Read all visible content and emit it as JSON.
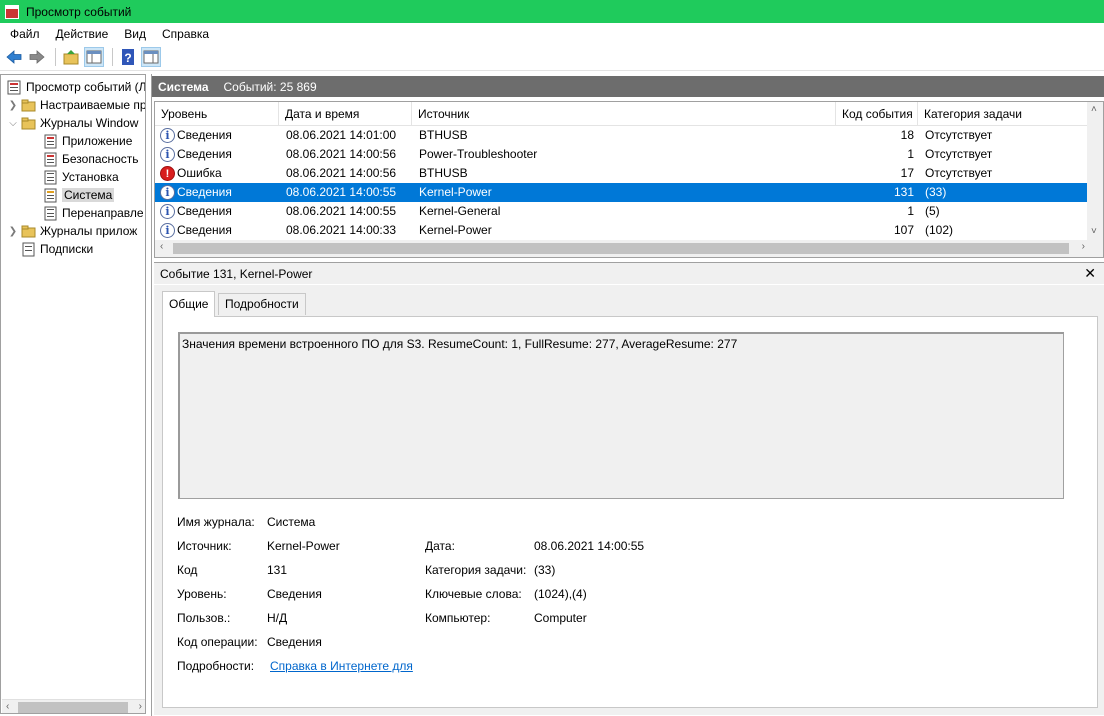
{
  "window": {
    "title": "Просмотр событий"
  },
  "menu": [
    "Файл",
    "Действие",
    "Вид",
    "Справка"
  ],
  "tree": {
    "root": "Просмотр событий (Л",
    "custom_views": "Настраиваемые пр",
    "windows_logs": "Журналы Window",
    "logs": [
      "Приложение",
      "Безопасность",
      "Установка",
      "Система",
      "Перенаправле"
    ],
    "app_logs": "Журналы прилож",
    "subscriptions": "Подписки"
  },
  "header": {
    "title": "Система",
    "count": "Событий: 25 869"
  },
  "columns": [
    "Уровень",
    "Дата и время",
    "Источник",
    "Код события",
    "Категория задачи"
  ],
  "events": [
    {
      "level": "Сведения",
      "type": "info",
      "date": "08.06.2021 14:01:00",
      "source": "BTHUSB",
      "code": "18",
      "category": "Отсутствует"
    },
    {
      "level": "Сведения",
      "type": "info",
      "date": "08.06.2021 14:00:56",
      "source": "Power-Troubleshooter",
      "code": "1",
      "category": "Отсутствует"
    },
    {
      "level": "Ошибка",
      "type": "error",
      "date": "08.06.2021 14:00:56",
      "source": "BTHUSB",
      "code": "17",
      "category": "Отсутствует"
    },
    {
      "level": "Сведения",
      "type": "info",
      "date": "08.06.2021 14:00:55",
      "source": "Kernel-Power",
      "code": "131",
      "category": "(33)",
      "selected": true
    },
    {
      "level": "Сведения",
      "type": "info",
      "date": "08.06.2021 14:00:55",
      "source": "Kernel-General",
      "code": "1",
      "category": "(5)"
    },
    {
      "level": "Сведения",
      "type": "info",
      "date": "08.06.2021 14:00:33",
      "source": "Kernel-Power",
      "code": "107",
      "category": "(102)"
    }
  ],
  "detail": {
    "title": "Событие 131, Kernel-Power",
    "tabs": [
      "Общие",
      "Подробности"
    ],
    "description": "Значения времени встроенного ПО для S3. ResumeCount: 1, FullResume: 277, AverageResume: 277",
    "props": {
      "log_name_label": "Имя журнала:",
      "log_name": "Система",
      "source_label": "Источник:",
      "source": "Kernel-Power",
      "date_label": "Дата:",
      "date": "08.06.2021 14:00:55",
      "code_label": "Код",
      "code": "131",
      "category_label": "Категория задачи:",
      "category": "(33)",
      "level_label": "Уровень:",
      "level": "Сведения",
      "keywords_label": "Ключевые слова:",
      "keywords": "(1024),(4)",
      "user_label": "Пользов.:",
      "user": "Н/Д",
      "computer_label": "Компьютер:",
      "computer": "Computer",
      "opcode_label": "Код операции:",
      "opcode": "Сведения",
      "more_label": "Подробности:",
      "more_link": "Справка в Интернете для"
    }
  }
}
